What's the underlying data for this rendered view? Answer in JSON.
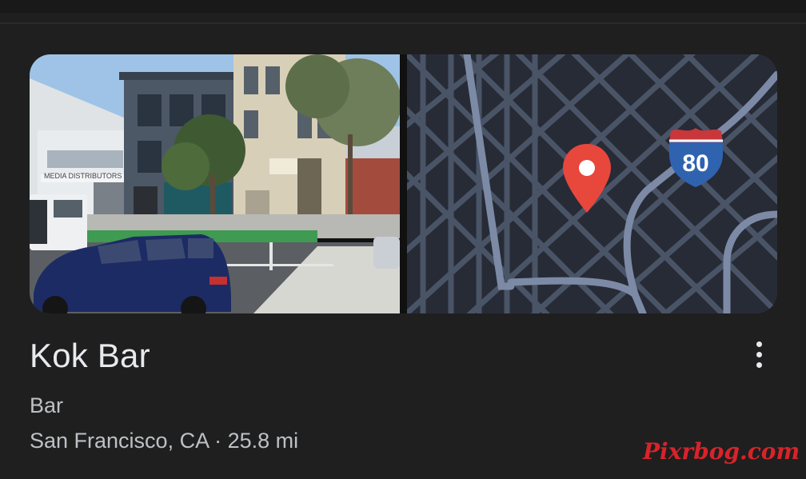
{
  "place": {
    "name": "Kok Bar",
    "category": "Bar",
    "location": "San Francisco, CA · 25.8 mi"
  },
  "media": {
    "photo_signage": "MEDIA DISTRIBUTORS",
    "map_shield_number": "80"
  },
  "icons": {
    "more": "more-vert-icon",
    "pin": "map-pin-icon",
    "shield": "interstate-shield-icon"
  },
  "colors": {
    "background": "#1f1f1f",
    "pin": "#e8473b",
    "map_background": "#272b36",
    "map_roads": "#4a5467",
    "map_highway": "#7c8aa6",
    "shield_blue": "#2f63b0",
    "shield_red": "#c8373a"
  },
  "watermark": "Pixrbog.com"
}
